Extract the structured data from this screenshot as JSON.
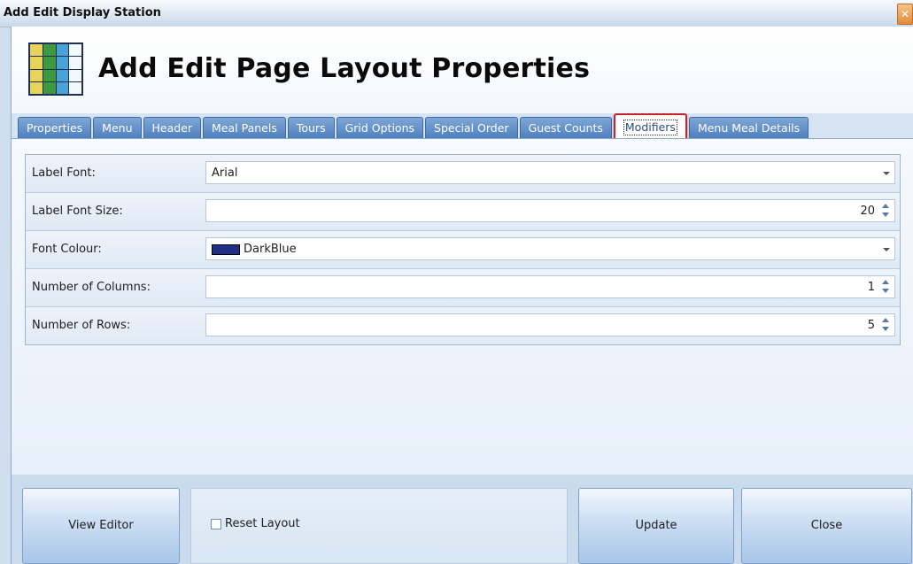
{
  "window": {
    "title": "Add Edit Display Station",
    "close_symbol": "✕"
  },
  "header": {
    "title": "Add Edit Page Layout Properties",
    "logo_icon": "grid-layout-icon",
    "logo_colors": [
      "#e9d35a",
      "#3e9a3f",
      "#4aa2d8",
      "#f3f8fd"
    ]
  },
  "tabs": [
    {
      "label": "Properties",
      "active": false
    },
    {
      "label": "Menu",
      "active": false
    },
    {
      "label": "Header",
      "active": false
    },
    {
      "label": "Meal Panels",
      "active": false
    },
    {
      "label": "Tours",
      "active": false
    },
    {
      "label": "Grid Options",
      "active": false
    },
    {
      "label": "Special Order",
      "active": false
    },
    {
      "label": "Guest Counts",
      "active": false
    },
    {
      "label": "Modifiers",
      "active": true
    },
    {
      "label": "Menu Meal Details",
      "active": false
    }
  ],
  "form": {
    "label_font": {
      "label": "Label Font:",
      "value": "Arial"
    },
    "label_font_size": {
      "label": "Label Font Size:",
      "value": "20"
    },
    "font_colour": {
      "label": "Font Colour:",
      "value": "DarkBlue",
      "swatch": "#1f2f86"
    },
    "num_columns": {
      "label": "Number of Columns:",
      "value": "1"
    },
    "num_rows": {
      "label": "Number of Rows:",
      "value": "5"
    }
  },
  "footer": {
    "view_editor": "View Editor",
    "reset_layout": "Reset Layout",
    "reset_checked": false,
    "update": "Update",
    "close": "Close"
  },
  "colors": {
    "tab_active_highlight": "#c8232c",
    "tab_bg": "#5b8ac6"
  }
}
